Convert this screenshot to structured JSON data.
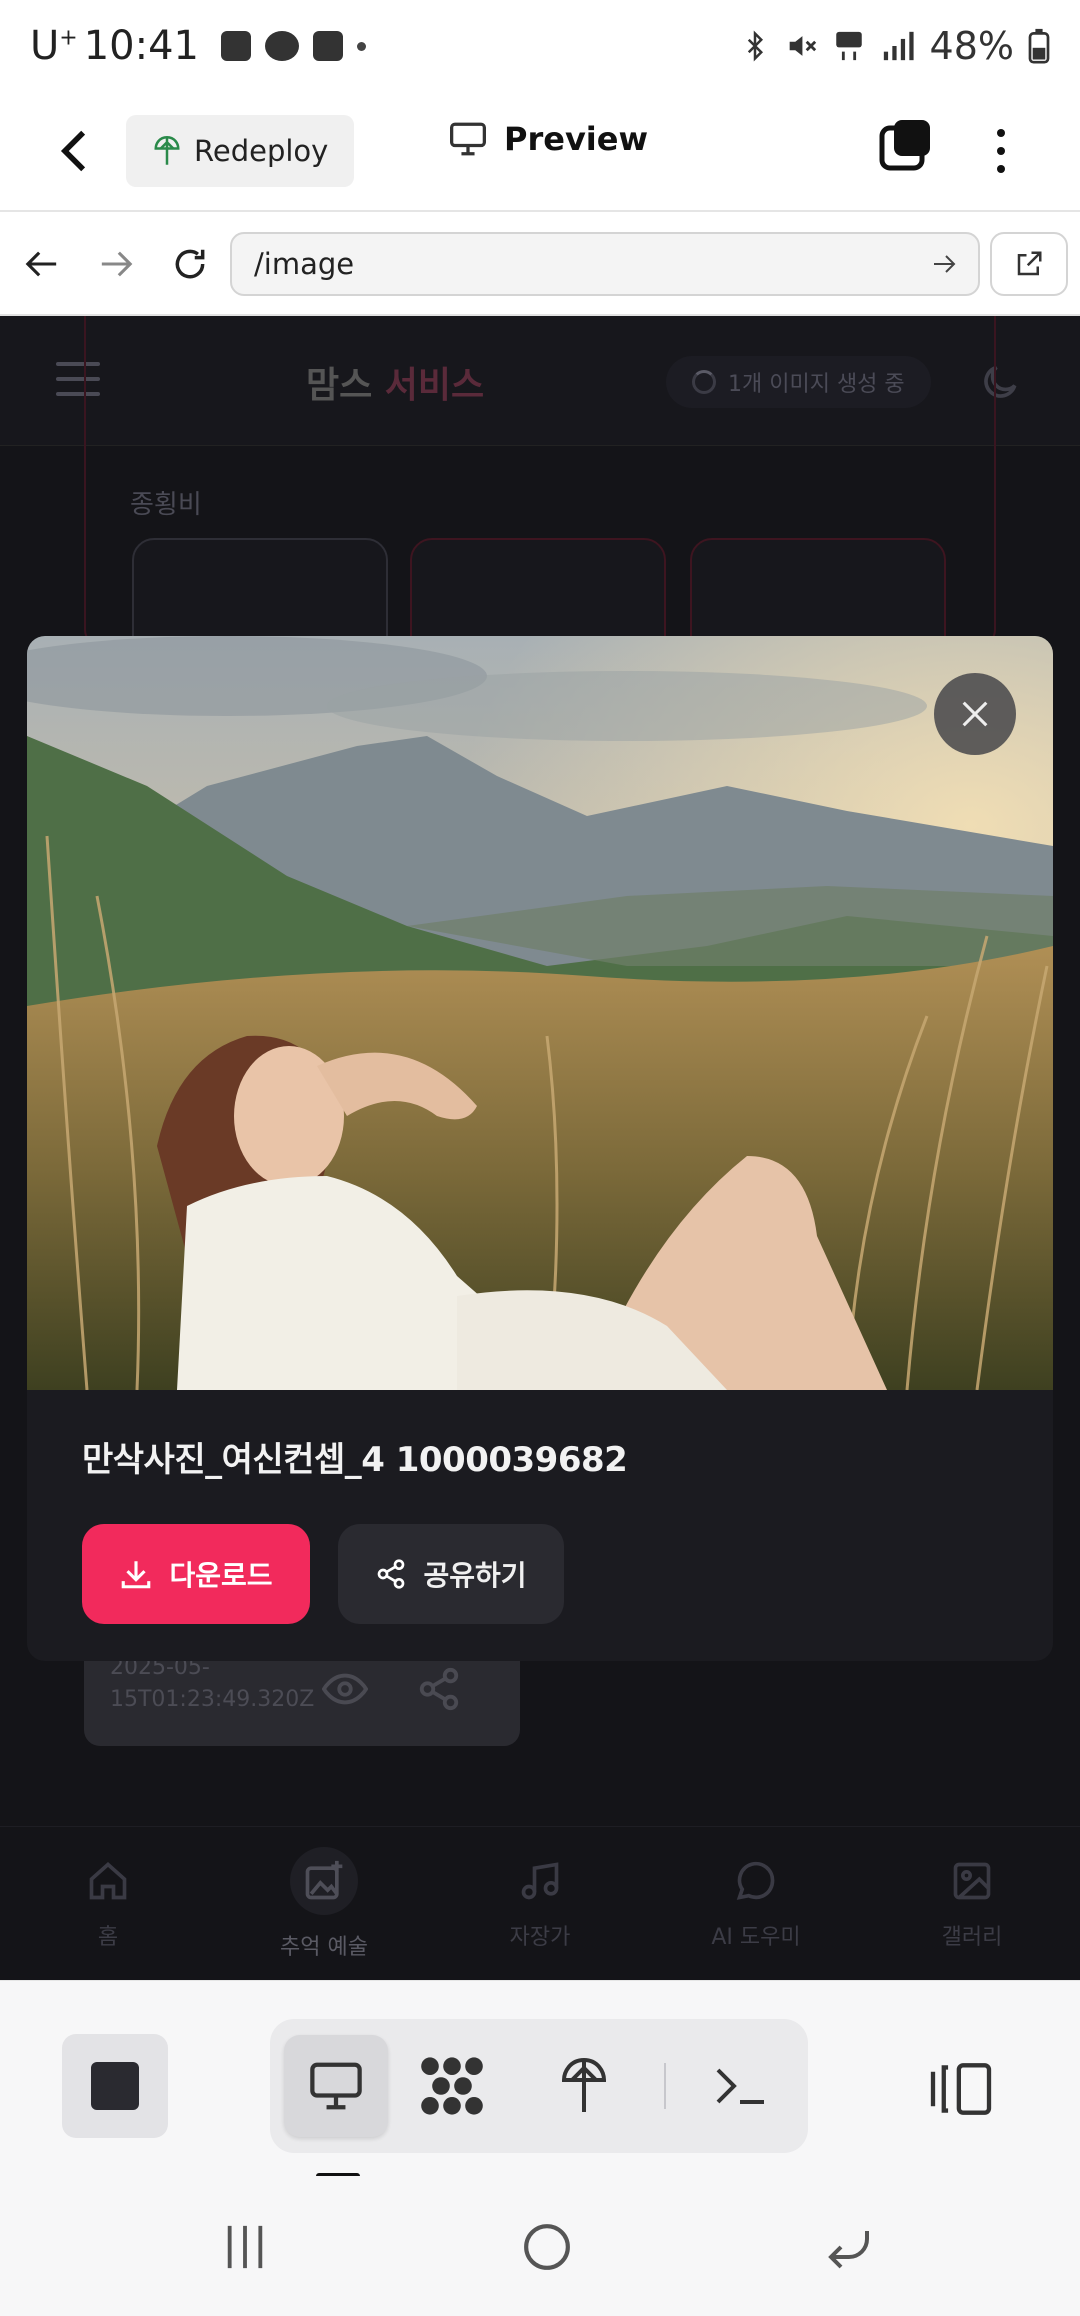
{
  "status_bar": {
    "carrier": "U",
    "carrier_sup": "+",
    "time": "10:41",
    "battery": "48%"
  },
  "app_bar": {
    "redeploy_label": "Redeploy",
    "preview_label": "Preview"
  },
  "url_bar": {
    "url": "/image"
  },
  "web": {
    "brand_main": "맘스 ",
    "brand_accent": "서비스",
    "generating_badge": "1개 이미지 생성 중",
    "ratio_label": "종횡비",
    "item_timestamp": "2025-05-15T01:23:49.320Z",
    "bottom_nav": [
      {
        "label": "홈",
        "icon": "home-icon"
      },
      {
        "label": "추억 예술",
        "icon": "image-plus-icon"
      },
      {
        "label": "자장가",
        "icon": "music-icon"
      },
      {
        "label": "AI 도우미",
        "icon": "chat-icon"
      },
      {
        "label": "갤러리",
        "icon": "gallery-icon"
      }
    ]
  },
  "modal": {
    "caption": "만삭사진_여신컨셉_4 1000039682",
    "download_label": "다운로드",
    "share_label": "공유하기"
  },
  "colors": {
    "accent": "#f22a5c",
    "modal_bg": "#1b1b20",
    "overlay_bg": "#141418"
  }
}
